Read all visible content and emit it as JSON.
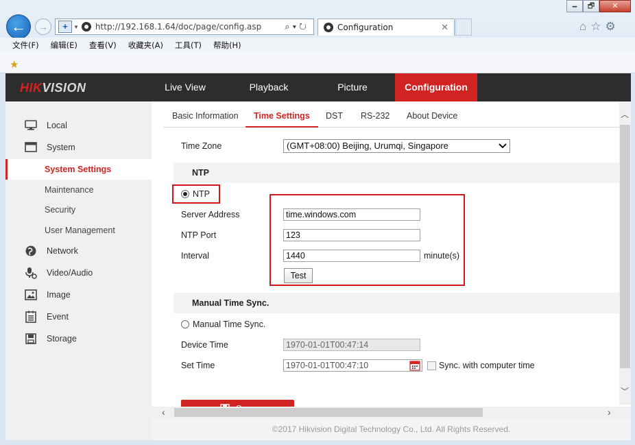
{
  "browser": {
    "window_buttons": [
      "🗕",
      "🗗",
      "✕"
    ],
    "url": "http://192.168.1.64/doc/page/config.asp",
    "tab_title": "Configuration",
    "menu": [
      "文件(F)",
      "编辑(E)",
      "查看(V)",
      "收藏夹(A)",
      "工具(T)",
      "帮助(H)"
    ]
  },
  "header": {
    "logo_part1": "HIK",
    "logo_part2": "VISION",
    "nav": [
      "Live View",
      "Playback",
      "Picture",
      "Configuration"
    ],
    "active_nav": "Configuration"
  },
  "sidebar": {
    "local": "Local",
    "system": "System",
    "system_settings": "System Settings",
    "maintenance": "Maintenance",
    "security": "Security",
    "user_management": "User Management",
    "network": "Network",
    "video_audio": "Video/Audio",
    "image": "Image",
    "event": "Event",
    "storage": "Storage"
  },
  "tabs": [
    "Basic Information",
    "Time Settings",
    "DST",
    "RS-232",
    "About Device"
  ],
  "active_tab": "Time Settings",
  "form": {
    "time_zone_label": "Time Zone",
    "time_zone_value": "(GMT+08:00) Beijing, Urumqi, Singapore",
    "ntp_section": "NTP",
    "ntp_radio_label": "NTP",
    "server_address_label": "Server Address",
    "server_address_value": "time.windows.com",
    "ntp_port_label": "NTP Port",
    "ntp_port_value": "123",
    "interval_label": "Interval",
    "interval_value": "1440",
    "interval_unit": "minute(s)",
    "test_button": "Test",
    "manual_section": "Manual Time Sync.",
    "manual_radio_label": "Manual Time Sync.",
    "device_time_label": "Device Time",
    "device_time_value": "1970-01-01T00:47:14",
    "set_time_label": "Set Time",
    "set_time_value": "1970-01-01T00:47:10",
    "sync_checkbox_label": "Sync. with computer time",
    "save_button": "Save"
  },
  "footer": "©2017 Hikvision Digital Technology Co., Ltd. All Rights Reserved.",
  "colors": {
    "accent": "#d22323",
    "topbar": "#2d2d2d",
    "sidebar": "#eef0f2",
    "highlight_box": "#d0171c"
  }
}
